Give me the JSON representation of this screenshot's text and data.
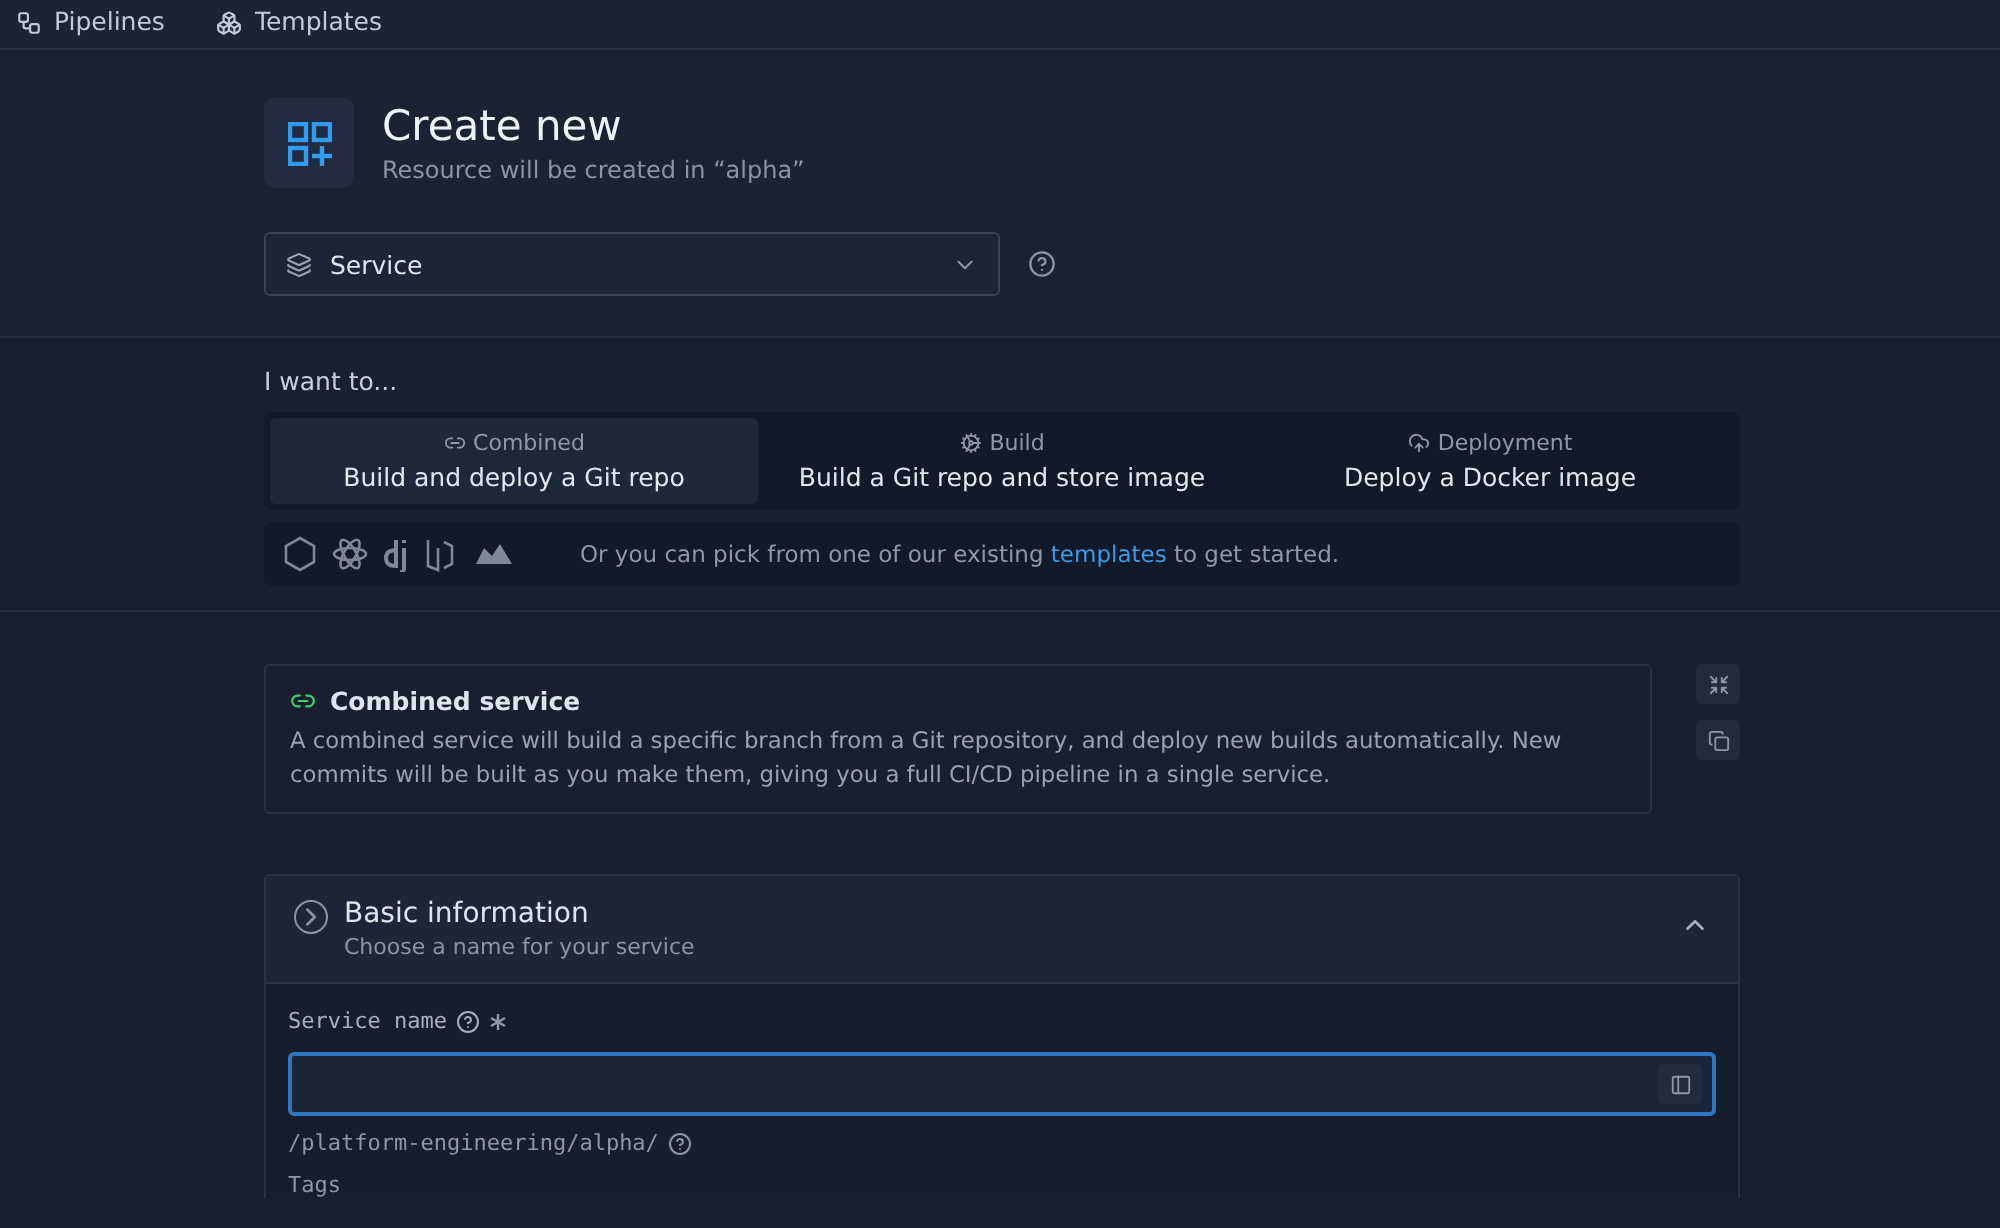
{
  "nav": [
    {
      "label": "Pipelines"
    },
    {
      "label": "Templates"
    }
  ],
  "header": {
    "title": "Create new",
    "subtitle": "Resource will be created in “alpha”"
  },
  "resource_select": {
    "value": "Service"
  },
  "intent": {
    "label": "I want to...",
    "options": [
      {
        "kind": "combined",
        "category": "Combined",
        "title": "Build and deploy a Git repo",
        "selected": true
      },
      {
        "kind": "build",
        "category": "Build",
        "title": "Build a Git repo and store image",
        "selected": false
      },
      {
        "kind": "deployment",
        "category": "Deployment",
        "title": "Deploy a Docker image",
        "selected": false
      }
    ],
    "templates_note": {
      "before": "Or you can pick from one of our existing",
      "link": "templates",
      "after": "to get started."
    }
  },
  "info_card": {
    "title": "Combined service",
    "body": "A combined service will build a specific branch from a Git repository, and deploy new builds automatically. New commits will be built as you make them, giving you a full CI/CD pipeline in a single service."
  },
  "section": {
    "title": "Basic information",
    "subtitle": "Choose a name for your service",
    "expanded": true,
    "fields": [
      {
        "label": "Service name",
        "required": true,
        "hint": "/platform-engineering/alpha/"
      }
    ],
    "next_label": "Tags"
  }
}
